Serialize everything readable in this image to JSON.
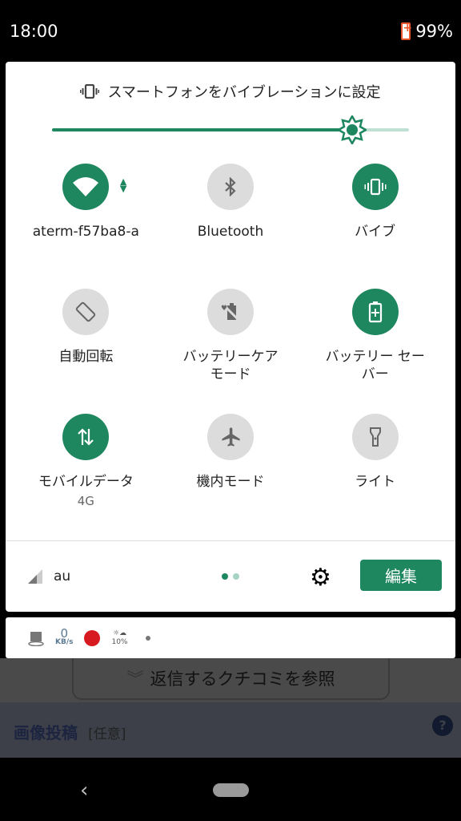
{
  "status": {
    "time": "18:00",
    "battery": "99%"
  },
  "ringer": {
    "label": "スマートフォンをバイブレーションに設定",
    "slider_percent": 84
  },
  "tiles": [
    {
      "label": "aterm-f57ba8-a",
      "icon": "wifi-icon",
      "on": true
    },
    {
      "label": "Bluetooth",
      "icon": "bluetooth-icon",
      "on": false
    },
    {
      "label": "バイブ",
      "icon": "vibrate-icon",
      "on": true
    },
    {
      "label": "自動回転",
      "icon": "rotate-icon",
      "on": false
    },
    {
      "label": "バッテリーケア\nモード",
      "icon": "battery-care-icon",
      "on": false
    },
    {
      "label": "バッテリー セー\nバー",
      "icon": "battery-saver-icon",
      "on": true
    },
    {
      "label": "モバイルデータ",
      "sub": "4G",
      "icon": "mobile-data-icon",
      "on": true
    },
    {
      "label": "機内モード",
      "icon": "airplane-icon",
      "on": false
    },
    {
      "label": "ライト",
      "icon": "flashlight-icon",
      "on": false
    }
  ],
  "footer": {
    "carrier": "au",
    "edit_label": "編集",
    "page": 1,
    "pages": 2
  },
  "notif": {
    "speed_value": "0",
    "speed_unit": "KB/s",
    "weather_percent": "10%"
  },
  "page": {
    "reply_button": "返信するクチコミを参照",
    "section_title": "画像投稿",
    "section_tag": "[任意]"
  },
  "colors": {
    "accent": "#1e8760",
    "inactive": "#dcdcdc"
  }
}
